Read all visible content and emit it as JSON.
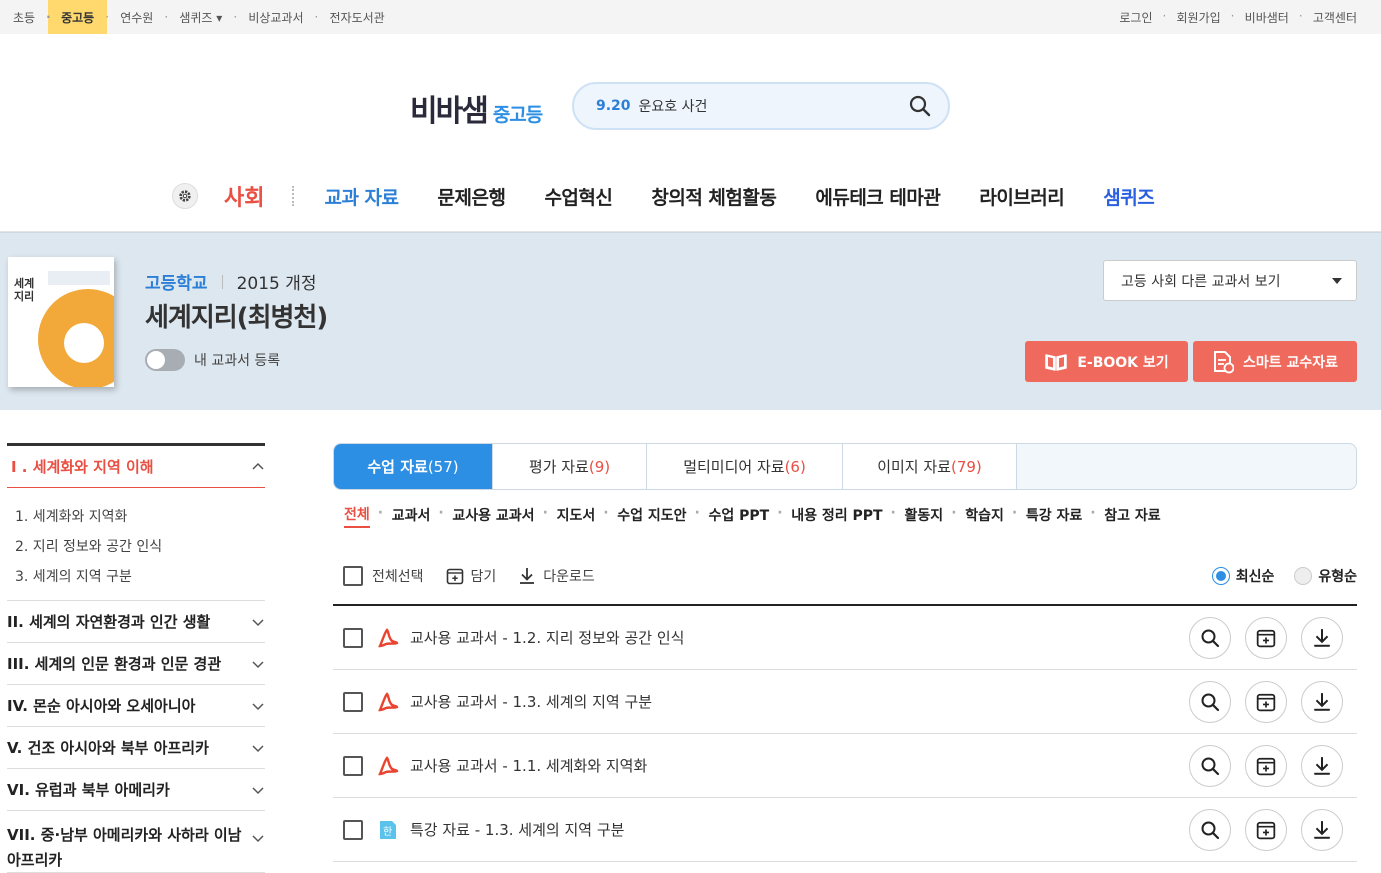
{
  "topbar": {
    "left": [
      "초등",
      "중고등",
      "연수원",
      "샘퀴즈 ▾",
      "비상교과서",
      "전자도서관"
    ],
    "right": [
      "로그인",
      "회원가입",
      "비바샘터",
      "고객센터"
    ]
  },
  "logo": {
    "main": "비바샘",
    "sub": "중고등"
  },
  "search": {
    "keyword": "9.20",
    "text": "운요호 사건"
  },
  "nav": {
    "subject": "사회",
    "items": [
      "교과 자료",
      "문제은행",
      "수업혁신",
      "창의적 체험활동",
      "에듀테크 테마관",
      "라이브러리",
      "샘퀴즈"
    ]
  },
  "book": {
    "cover_title": "세계\n지리",
    "school": "고등학교",
    "revision": "2015 개정",
    "name": "세계지리(최병천)",
    "toggle_label": "내 교과서 등록",
    "other_books": "고등 사회 다른 교과서 보기",
    "ebook_btn": "E-BOOK 보기",
    "smart_btn": "스마트 교수자료"
  },
  "lnb": {
    "current": "I . 세계화와 지역 이해",
    "subs": [
      "1. 세계화와 지역화",
      "2. 지리 정보와 공간 인식",
      "3. 세계의 지역 구분"
    ],
    "sections": [
      "II. 세계의 자연환경과 인간 생활",
      "III. 세계의 인문 환경과 인문 경관",
      "IV. 몬순 아시아와 오세아니아",
      "V. 건조 아시아와 북부 아프리카",
      "VI. 유럽과 북부 아메리카",
      "VII. 중·남부 아메리카와 사하라 이남 아프리카"
    ]
  },
  "tabs": [
    {
      "label": "수업 자료 ",
      "count": "(57)"
    },
    {
      "label": "평가 자료 ",
      "count": "(9)"
    },
    {
      "label": "멀티미디어 자료 ",
      "count": "(6)"
    },
    {
      "label": "이미지 자료 ",
      "count": "(79)"
    }
  ],
  "filters": [
    "전체",
    "교과서",
    "교사용 교과서",
    "지도서",
    "수업 지도안",
    "수업 PPT",
    "내용 정리 PPT",
    "활동지",
    "학습지",
    "특강 자료",
    "참고 자료"
  ],
  "toolbar": {
    "select_all": "전체선택",
    "save": "담기",
    "download": "다운로드",
    "sort_new": "최신순",
    "sort_type": "유형순"
  },
  "rows": [
    {
      "type": "pdf",
      "title": "교사용 교과서 - 1.2. 지리 정보와 공간 인식"
    },
    {
      "type": "pdf",
      "title": "교사용 교과서 - 1.3. 세계의 지역 구분"
    },
    {
      "type": "pdf",
      "title": "교사용 교과서 - 1.1. 세계화와 지역화"
    },
    {
      "type": "hwp",
      "title": "특강 자료 - 1.3. 세계의 지역 구분"
    }
  ],
  "colors": {
    "accent": "#2c8fe3",
    "red": "#e94f43",
    "button": "#ef6a5c",
    "banner": "#dde7ef"
  }
}
